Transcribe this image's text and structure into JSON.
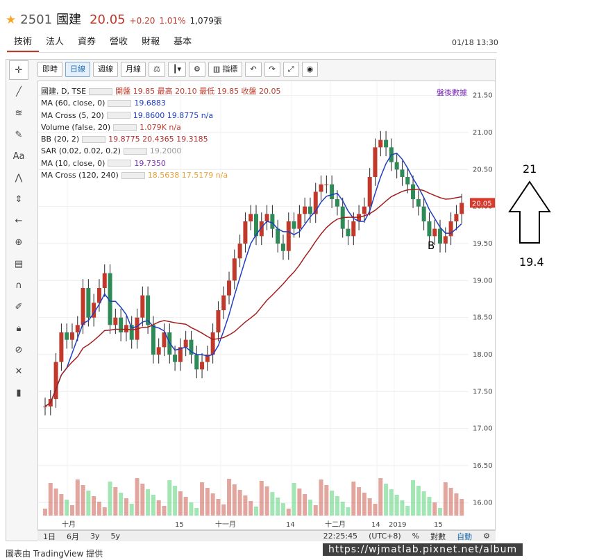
{
  "header": {
    "code": "2501",
    "name": "國建",
    "price": "20.05",
    "change": "+0.20",
    "change_pct": "1.01%",
    "volume": "1,079張"
  },
  "tabs": [
    {
      "label": "技術"
    },
    {
      "label": "法人"
    },
    {
      "label": "資券"
    },
    {
      "label": "營收"
    },
    {
      "label": "財報"
    },
    {
      "label": "基本"
    }
  ],
  "timestamp": "01/18 13:30",
  "toolbar": {
    "realtime": "即時",
    "daily": "日線",
    "weekly": "週線",
    "monthly": "月線",
    "indicators": "指標"
  },
  "legend": [
    {
      "label": "國建, D, TSE",
      "extra": "開盤 19.85 最高 20.10 最低 19.85 收盤 20.05",
      "color": "#c0392b"
    },
    {
      "label": "MA (60, close, 0)",
      "extra": "19.6883",
      "color": "#1f3fbf"
    },
    {
      "label": "MA Cross (5, 20)",
      "extra": "19.8600 19.8775 n/a",
      "color": "#1f3fbf"
    },
    {
      "label": "Volume (false, 20)",
      "extra": "1.079K n/a",
      "color": "#c0392b"
    },
    {
      "label": "BB (20, 2)",
      "extra": "19.8775 20.4365 19.3185",
      "color": "#b03030"
    },
    {
      "label": "SAR (0.02, 0.02, 0.2)",
      "extra": "19.2000",
      "color": "#999999"
    },
    {
      "label": "MA (10, close, 0)",
      "extra": "19.7350",
      "color": "#7a2fb5"
    },
    {
      "label": "MA Cross (120, 240)",
      "extra": "18.5638 17.5179 n/a",
      "color": "#e8a23a"
    }
  ],
  "after_hours": "盤後數據",
  "y_axis": [
    "21.50",
    "21.00",
    "20.50",
    "20.00",
    "19.50",
    "19.00",
    "18.50",
    "18.00",
    "17.50",
    "17.00",
    "16.50",
    "16.00"
  ],
  "x_axis": [
    "十月",
    "15",
    "十一月",
    "14",
    "十二月",
    "14",
    "2019",
    "15"
  ],
  "last_price_tag": "20.05",
  "bottom": {
    "r1": "1日",
    "r2": "6月",
    "r3": "3y",
    "r4": "5y",
    "clock": "22:25:45",
    "tz": "(UTC+8)",
    "pct": "%",
    "log": "對數",
    "auto": "自動"
  },
  "marker_b": "B",
  "annotation": {
    "top": "21",
    "bottom": "19.4"
  },
  "credit": "圖表由 TradingView 提供",
  "watermark": "https://wjmatlab.pixnet.net/album",
  "chart_data": {
    "type": "candlestick",
    "closes": [
      17.3,
      17.4,
      17.9,
      18.3,
      18.2,
      18.3,
      18.4,
      18.9,
      18.5,
      18.7,
      18.9,
      19.1,
      18.4,
      18.5,
      18.3,
      18.4,
      18.2,
      18.5,
      18.8,
      18.4,
      18.0,
      18.1,
      18.3,
      18.0,
      17.9,
      18.1,
      18.2,
      18.0,
      17.8,
      17.9,
      18.0,
      18.3,
      18.6,
      18.8,
      19.0,
      19.3,
      19.5,
      19.8,
      19.9,
      19.6,
      19.8,
      19.9,
      19.7,
      19.5,
      19.4,
      19.8,
      19.7,
      19.9,
      20.0,
      19.9,
      20.2,
      20.3,
      20.3,
      20.1,
      20.0,
      19.7,
      19.6,
      19.8,
      19.9,
      20.0,
      20.4,
      20.8,
      20.9,
      20.8,
      20.6,
      20.5,
      20.4,
      20.3,
      20.1,
      20.0,
      19.8,
      19.6,
      19.7,
      19.5,
      19.6,
      19.8,
      19.9,
      20.05
    ],
    "ylim": [
      15.9,
      21.6
    ]
  }
}
